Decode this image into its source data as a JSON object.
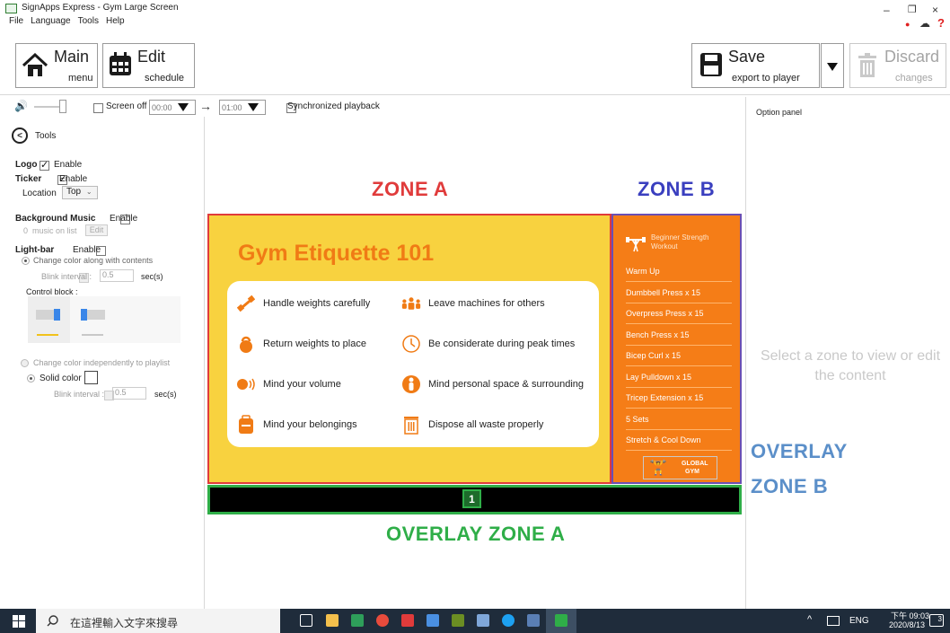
{
  "window": {
    "title": "SignApps Express - Gym Large Screen",
    "menu": [
      "File",
      "Language",
      "Tools",
      "Help"
    ],
    "controls": {
      "minimize": "–",
      "restore": "❐",
      "close": "×"
    },
    "status_icons": {
      "dot": "●",
      "cloud": "☁",
      "help": "?"
    }
  },
  "toolbar": {
    "main": {
      "title": "Main",
      "subtitle": "menu"
    },
    "edit": {
      "title": "Edit",
      "subtitle": "schedule"
    },
    "save": {
      "title": "Save",
      "subtitle": "export to player"
    },
    "discard": {
      "title": "Discard",
      "subtitle": "changes"
    }
  },
  "playback": {
    "screen_off_label": "Screen off",
    "time_from": "00:00",
    "time_to": "01:00",
    "sync_label": "Synchronized playback",
    "volume_level": 0.0
  },
  "tools_panel": {
    "header": "Tools",
    "logo_label": "Logo",
    "ticker_label": "Ticker",
    "enable": "Enable",
    "location_label": "Location",
    "location_value": "Top",
    "bg_music_label": "Background Music",
    "music_count": "0",
    "music_on_list": "music on list",
    "edit_btn": "Edit",
    "lightbar_label": "Light-bar",
    "change_along": "Change color along with contents",
    "blink_interval": "Blink interval :",
    "blink_value": "0.5",
    "secs": "sec(s)",
    "control_block": "Control block :",
    "change_indep": "Change color independently to playlist",
    "solid_color": "Solid color",
    "blink_value2": "0.5"
  },
  "zones": {
    "zone_a_label": "ZONE A",
    "zone_b_label": "ZONE B",
    "overlay_a_label": "OVERLAY ZONE A",
    "overlay_b_line1": "OVERLAY",
    "overlay_b_line2": "ZONE B",
    "overlay_a_badge": "1"
  },
  "zone_a": {
    "title": "Gym Etiquette 101",
    "items": [
      "Handle weights carefully",
      "Leave machines for others",
      "Return weights to place",
      "Be considerate during peak times",
      "Mind your volume",
      "Mind personal space & surrounding",
      "Mind your belongings",
      "Dispose all waste properly"
    ]
  },
  "zone_b": {
    "header_line1": "Beginner Strength",
    "header_line2": "Workout",
    "items": [
      "Warm Up",
      "Dumbbell Press x 15",
      "Overpress Press x 15",
      "Bench Press x 15",
      "Bicep Curl x 15",
      "Lay Pulldown x 15",
      "Tricep Extension x 15",
      "5 Sets",
      "Stretch & Cool Down"
    ],
    "logo_line1": "GLOBAL",
    "logo_line2": "GYM"
  },
  "option_panel": {
    "title": "Option panel",
    "hint": "Select a zone to view or edit the content"
  },
  "taskbar": {
    "search_placeholder": "在這裡輸入文字來搜尋",
    "lang": "ENG",
    "time": "下午 09:03",
    "date": "2020/8/13",
    "notif_count": "3"
  },
  "colors": {
    "zone_a_label": "#e03b3b",
    "zone_b_label": "#3a3fbf",
    "overlay_a": "#2fae48",
    "overlay_b": "#5b8fc9",
    "zone_a_bg": "#f8d23f",
    "zone_b_bg": "#f57d17"
  }
}
